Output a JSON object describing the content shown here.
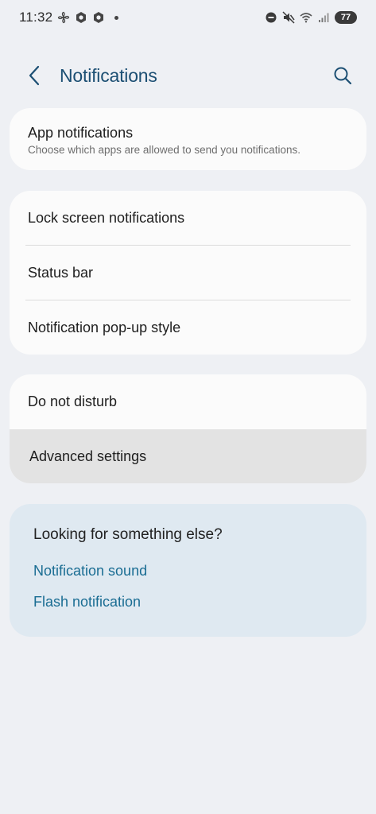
{
  "status_bar": {
    "time": "11:32",
    "battery": "77",
    "left_icons": [
      "pinwheel-icon",
      "hexagon-app-icon",
      "hexagon-app-icon"
    ],
    "right_icons": [
      "do-not-disturb-icon",
      "mute-icon",
      "wifi-icon",
      "signal-icon",
      "battery-icon"
    ]
  },
  "header": {
    "title": "Notifications",
    "back_icon": "chevron-left-icon",
    "search_icon": "search-icon"
  },
  "sections": {
    "app_notifications": {
      "title": "App notifications",
      "subtitle": "Choose which apps are allowed to send you notifications."
    },
    "group_two": [
      {
        "label": "Lock screen notifications"
      },
      {
        "label": "Status bar"
      },
      {
        "label": "Notification pop-up style"
      }
    ],
    "group_three": [
      {
        "label": "Do not disturb"
      },
      {
        "label": "Advanced settings"
      }
    ]
  },
  "suggestions": {
    "heading": "Looking for something else?",
    "links": [
      {
        "label": "Notification sound"
      },
      {
        "label": "Flash notification"
      }
    ]
  },
  "colors": {
    "background": "#eef0f4",
    "card": "#fbfbfb",
    "title": "#1c4f73",
    "link": "#1a6d93",
    "suggest_bg": "#dfe9f1",
    "pressed_row": "#e3e3e3"
  }
}
